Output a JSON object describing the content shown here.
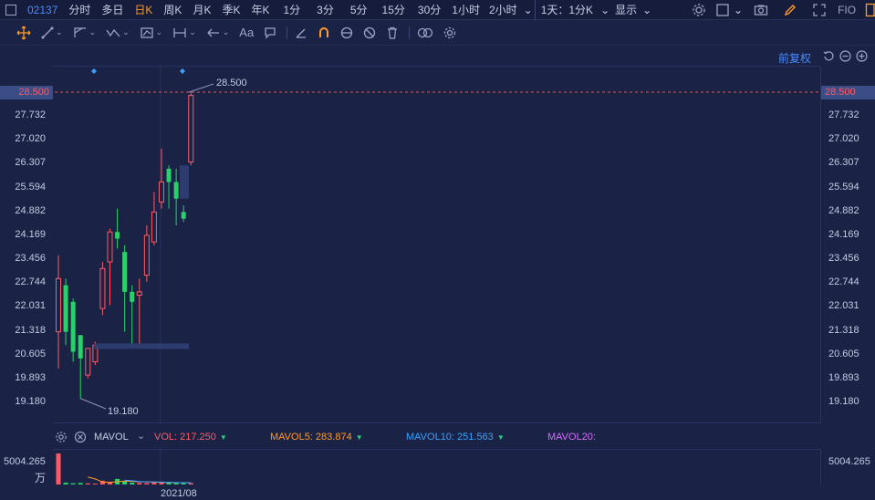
{
  "topbar": {
    "code": "02137",
    "periods": [
      "分时",
      "多日",
      "日K",
      "周K",
      "月K",
      "季K",
      "年K",
      "1分",
      "3分",
      "5分",
      "15分",
      "30分",
      "1小时",
      "2小时"
    ],
    "active_period": "日K",
    "period_dropdown_label": "1天：1分K",
    "display_label": "显示",
    "f10_label": "FIO"
  },
  "main": {
    "fuquan_label": "前复权",
    "price_tag": "28.500",
    "high_label": "28.500",
    "low_label": "19.180",
    "ticks": [
      "28.500",
      "27.732",
      "27.020",
      "26.307",
      "25.594",
      "24.882",
      "24.169",
      "23.456",
      "22.744",
      "22.031",
      "21.318",
      "20.605",
      "19.893",
      "19.180"
    ]
  },
  "indicator": {
    "name": "MAVOL",
    "vol": "VOL: 217.250",
    "mavol5": "MAVOL5: 283.874",
    "mavol10": "MAVOL10: 251.563",
    "mavol20": "MAVOL20:",
    "colors": {
      "vol": "#ff5a64",
      "mavol5": "#ff9a2a",
      "mavol10": "#3aa0ff",
      "mavol20": "#d86cff"
    }
  },
  "volume": {
    "max_label": "5004.265",
    "unit_label": "万"
  },
  "date_label": "2021/08",
  "chart_data": {
    "type": "candlestick",
    "ylim": [
      19.18,
      28.5
    ],
    "candles": [
      {
        "o": 21.3,
        "c": 22.9,
        "h": 23.6,
        "l": 20.2,
        "up": true
      },
      {
        "o": 22.7,
        "c": 21.3,
        "h": 22.9,
        "l": 20.9,
        "up": false
      },
      {
        "o": 22.2,
        "c": 20.7,
        "h": 22.3,
        "l": 20.4,
        "up": false
      },
      {
        "o": 21.2,
        "c": 20.5,
        "h": 21.2,
        "l": 19.3,
        "up": false
      },
      {
        "o": 20.0,
        "c": 20.8,
        "h": 20.8,
        "l": 19.9,
        "up": true
      },
      {
        "o": 20.4,
        "c": 20.9,
        "h": 21.0,
        "l": 20.3,
        "up": true
      },
      {
        "o": 22.0,
        "c": 23.2,
        "h": 23.4,
        "l": 21.8,
        "up": true
      },
      {
        "o": 23.4,
        "c": 24.3,
        "h": 24.4,
        "l": 22.1,
        "up": true
      },
      {
        "o": 24.3,
        "c": 24.1,
        "h": 25.0,
        "l": 23.8,
        "up": false
      },
      {
        "o": 23.7,
        "c": 22.5,
        "h": 23.9,
        "l": 21.3,
        "up": false
      },
      {
        "o": 22.5,
        "c": 22.2,
        "h": 22.7,
        "l": 20.9,
        "up": false
      },
      {
        "o": 22.4,
        "c": 22.5,
        "h": 22.9,
        "l": 20.9,
        "up": true
      },
      {
        "o": 23.0,
        "c": 24.2,
        "h": 24.5,
        "l": 22.8,
        "up": true
      },
      {
        "o": 24.0,
        "c": 24.9,
        "h": 25.5,
        "l": 23.9,
        "up": true
      },
      {
        "o": 25.2,
        "c": 25.8,
        "h": 26.8,
        "l": 25.0,
        "up": true
      },
      {
        "o": 26.2,
        "c": 25.8,
        "h": 26.3,
        "l": 25.0,
        "up": false
      },
      {
        "o": 25.8,
        "c": 25.3,
        "h": 26.2,
        "l": 24.5,
        "up": false
      },
      {
        "o": 24.9,
        "c": 24.7,
        "h": 25.1,
        "l": 24.6,
        "up": false
      },
      {
        "o": 26.4,
        "c": 28.4,
        "h": 28.5,
        "l": 26.3,
        "up": true
      }
    ],
    "volumes": [
      5004.265,
      300,
      200,
      250,
      180,
      140,
      600,
      350,
      900,
      500,
      300,
      250,
      220,
      400,
      350,
      280,
      260,
      220,
      217.25
    ],
    "volume_ylim": [
      0,
      5004.265
    ]
  }
}
